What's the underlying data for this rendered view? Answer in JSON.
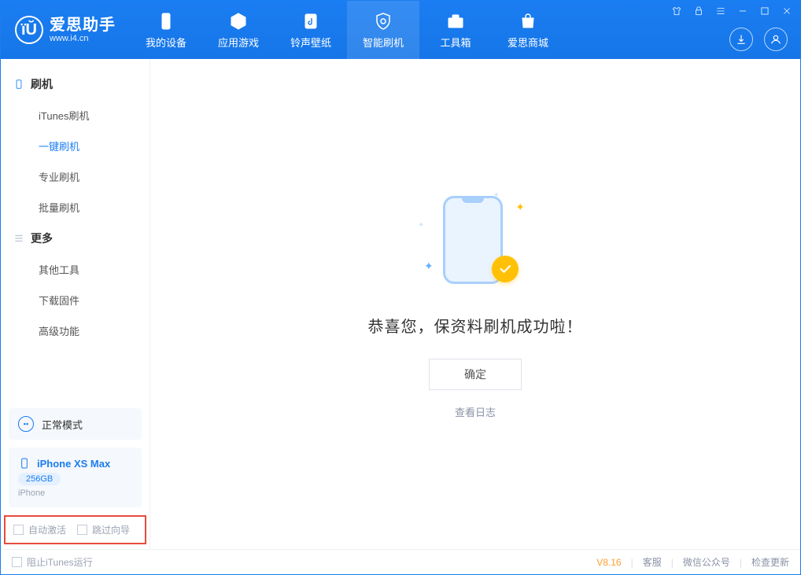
{
  "logo": {
    "title": "爱思助手",
    "subtitle": "www.i4.cn"
  },
  "nav": {
    "tabs": [
      {
        "label": "我的设备"
      },
      {
        "label": "应用游戏"
      },
      {
        "label": "铃声壁纸"
      },
      {
        "label": "智能刷机"
      },
      {
        "label": "工具箱"
      },
      {
        "label": "爱思商城"
      }
    ]
  },
  "sidebar": {
    "group1": {
      "title": "刷机",
      "items": [
        {
          "label": "iTunes刷机"
        },
        {
          "label": "一键刷机"
        },
        {
          "label": "专业刷机"
        },
        {
          "label": "批量刷机"
        }
      ]
    },
    "group2": {
      "title": "更多",
      "items": [
        {
          "label": "其他工具"
        },
        {
          "label": "下载固件"
        },
        {
          "label": "高级功能"
        }
      ]
    },
    "mode_label": "正常模式",
    "device": {
      "name": "iPhone XS Max",
      "storage": "256GB",
      "type": "iPhone"
    },
    "options": {
      "auto_activate": "自动激活",
      "skip_guide": "跳过向导"
    }
  },
  "main": {
    "success_text": "恭喜您，保资料刷机成功啦！",
    "ok_button": "确定",
    "view_log": "查看日志"
  },
  "footer": {
    "block_itunes": "阻止iTunes运行",
    "version": "V8.16",
    "support": "客服",
    "wechat": "微信公众号",
    "check_update": "检查更新"
  }
}
